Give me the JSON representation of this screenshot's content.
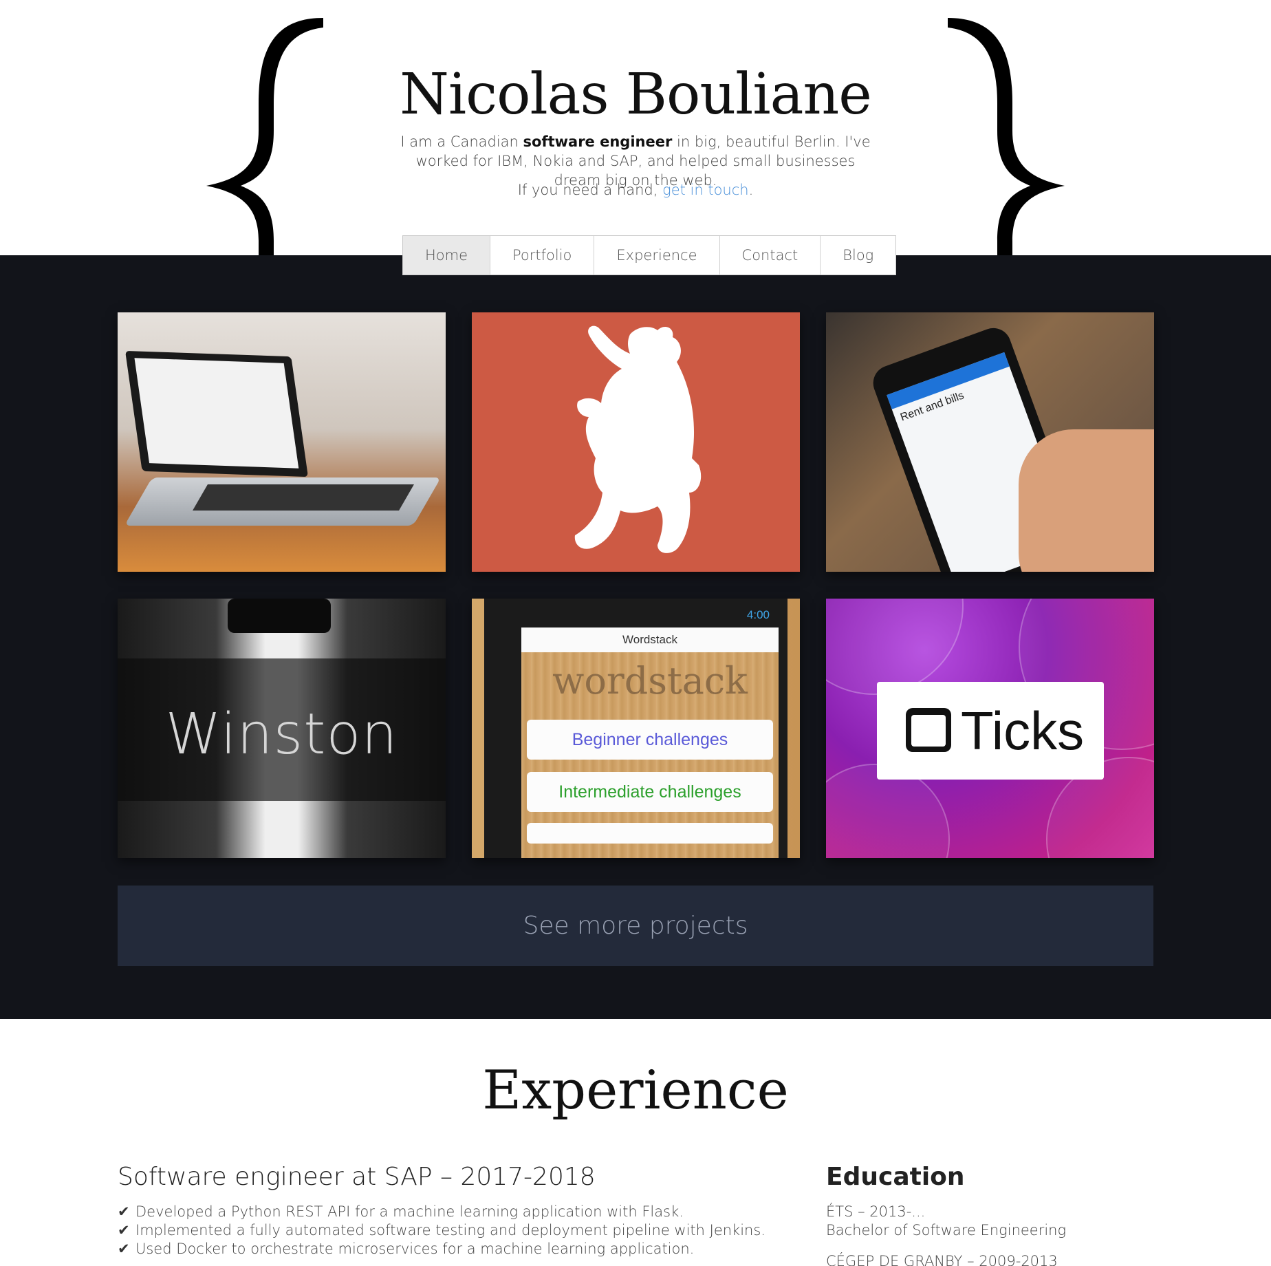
{
  "header": {
    "name": "Nicolas Bouliane",
    "intro_before": "I am a Canadian ",
    "intro_bold": "software engineer",
    "intro_after": " in big, beautiful Berlin. I've worked for IBM, Nokia and SAP, and helped small businesses dream big on the web.",
    "hand_before": "If you need a hand, ",
    "hand_link": "get in touch",
    "hand_after": "."
  },
  "nav": {
    "items": [
      {
        "label": "Home",
        "active": true
      },
      {
        "label": "Portfolio",
        "active": false
      },
      {
        "label": "Experience",
        "active": false
      },
      {
        "label": "Contact",
        "active": false
      },
      {
        "label": "Blog",
        "active": false
      }
    ]
  },
  "portfolio": {
    "tiles": [
      {
        "text": ""
      },
      {
        "text": ""
      },
      {
        "text": "Rent and bills"
      },
      {
        "text": "Winston"
      },
      {
        "status": "4:00",
        "app_title": "Wordstack",
        "logo": "wordstack",
        "btn1": "Beginner challenges",
        "btn2": "Intermediate challenges"
      },
      {
        "text": "Ticks"
      }
    ],
    "see_more": "See more projects"
  },
  "experience": {
    "title": "Experience",
    "job_title": "Software engineer at SAP – 2017-2018",
    "bullets": [
      "Developed a Python REST API for a machine learning application with Flask.",
      "Implemented a fully automated software testing and deployment pipeline with Jenkins.",
      "Used Docker to orchestrate microservices for a machine learning application."
    ],
    "education": {
      "title": "Education",
      "entries": [
        {
          "school": "ÉTS – 2013-...",
          "degree": "Bachelor of Software Engineering"
        },
        {
          "school": "CÉGEP DE GRANBY – 2009-2013",
          "degree": ""
        }
      ]
    }
  },
  "colors": {
    "dark_bg": "#12141a",
    "see_more_bg": "#232a3a",
    "link": "#4a90d9",
    "bear_bg": "#cd5a44"
  }
}
